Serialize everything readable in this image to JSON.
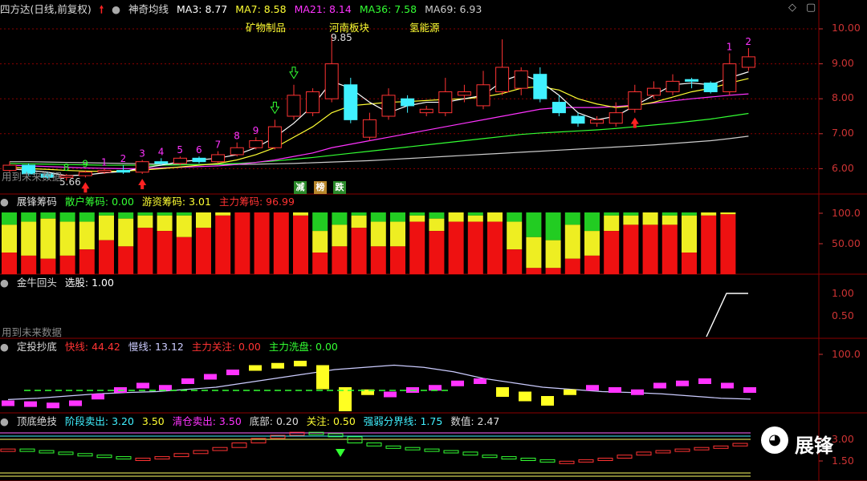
{
  "colors": {
    "up": "#ff3333",
    "down": "#40f0ff",
    "ma3": "#ffffff",
    "ma7": "#ffff33",
    "ma21": "#ff33ff",
    "ma36": "#33ff33",
    "ma69": "#cccccc",
    "grid": "#8b0000",
    "label": "#cc3333",
    "white": "#dddddd",
    "green": "#33ff33",
    "magenta": "#ff33ff",
    "yellow": "#ffff33",
    "cyan": "#40f0ff"
  },
  "panel1": {
    "title": "四方达(日线,前复权)",
    "indicator": "神奇均线",
    "ma3": "MA3: 8.77",
    "ma7": "MA7: 8.58",
    "ma21": "MA21: 8.14",
    "ma36": "MA36: 7.58",
    "ma69": "MA69: 6.93",
    "tags": [
      "矿物制品",
      "河南板块",
      "氢能源"
    ],
    "high_label": "9.85",
    "low_label": "5.66",
    "future_note": "用到未来数据",
    "boxes": [
      "减",
      "榜",
      "跌"
    ],
    "axis": [
      "10.00",
      "9.00",
      "8.00",
      "7.00",
      "6.00"
    ],
    "seq": [
      "8",
      "9",
      "1",
      "2",
      "3",
      "4",
      "5",
      "6",
      "7",
      "8",
      "9",
      "1",
      "2"
    ]
  },
  "panel2": {
    "title": "展锋筹码",
    "s1": "散户筹码: 0.00",
    "s2": "游资筹码: 3.01",
    "s3": "主力筹码: 96.99",
    "axis": [
      "100.0",
      "50.00"
    ]
  },
  "panel3": {
    "title": "金牛回头",
    "s1": "选股: 1.00",
    "note": "用到未来数据",
    "axis": [
      "1.00",
      "0.50"
    ]
  },
  "panel4": {
    "title": "定投抄底",
    "s1": "快线: 44.42",
    "s2": "慢线: 13.12",
    "s3": "主力关注: 0.00",
    "s4": "主力洗盘: 0.00",
    "axis": [
      "100.0"
    ]
  },
  "panel5": {
    "title": "顶底绝技",
    "s1": "阶段卖出: 3.20",
    "s2": "3.50",
    "s3": "清仓卖出: 3.50",
    "s4": "底部: 0.20",
    "s5": "关注: 0.50",
    "s6": "强弱分界线: 1.75",
    "s7": "数值: 2.47",
    "axis": [
      "3.00",
      "1.50"
    ]
  },
  "watermark": "展锋",
  "chart_data": {
    "type": "candlestick",
    "candles": [
      {
        "o": 5.95,
        "c": 6.1,
        "h": 6.2,
        "l": 5.9
      },
      {
        "o": 6.1,
        "c": 5.85,
        "h": 6.15,
        "l": 5.8
      },
      {
        "o": 5.85,
        "c": 5.75,
        "h": 5.9,
        "l": 5.7
      },
      {
        "o": 5.75,
        "c": 5.8,
        "h": 5.85,
        "l": 5.66
      },
      {
        "o": 5.8,
        "c": 5.9,
        "h": 5.95,
        "l": 5.75
      },
      {
        "o": 5.9,
        "c": 5.95,
        "h": 6.0,
        "l": 5.85
      },
      {
        "o": 5.95,
        "c": 5.9,
        "h": 6.1,
        "l": 5.85
      },
      {
        "o": 5.9,
        "c": 6.2,
        "h": 6.25,
        "l": 5.85
      },
      {
        "o": 6.2,
        "c": 6.15,
        "h": 6.3,
        "l": 6.1
      },
      {
        "o": 6.15,
        "c": 6.3,
        "h": 6.35,
        "l": 6.1
      },
      {
        "o": 6.3,
        "c": 6.2,
        "h": 6.35,
        "l": 6.15
      },
      {
        "o": 6.2,
        "c": 6.4,
        "h": 6.5,
        "l": 6.15
      },
      {
        "o": 6.4,
        "c": 6.6,
        "h": 6.75,
        "l": 6.35
      },
      {
        "o": 6.6,
        "c": 6.8,
        "h": 6.9,
        "l": 6.55
      },
      {
        "o": 6.6,
        "c": 7.2,
        "h": 7.4,
        "l": 6.55
      },
      {
        "o": 7.5,
        "c": 8.1,
        "h": 8.4,
        "l": 7.4
      },
      {
        "o": 7.6,
        "c": 8.2,
        "h": 8.3,
        "l": 7.5
      },
      {
        "o": 8.0,
        "c": 9.0,
        "h": 9.85,
        "l": 7.9
      },
      {
        "o": 8.4,
        "c": 7.4,
        "h": 8.6,
        "l": 7.3
      },
      {
        "o": 6.9,
        "c": 7.4,
        "h": 7.6,
        "l": 6.8
      },
      {
        "o": 7.5,
        "c": 8.1,
        "h": 8.3,
        "l": 7.4
      },
      {
        "o": 8.0,
        "c": 7.8,
        "h": 8.1,
        "l": 7.6
      },
      {
        "o": 7.6,
        "c": 7.7,
        "h": 7.8,
        "l": 7.5
      },
      {
        "o": 7.6,
        "c": 8.2,
        "h": 8.6,
        "l": 7.5
      },
      {
        "o": 8.1,
        "c": 8.2,
        "h": 8.4,
        "l": 7.9
      },
      {
        "o": 7.8,
        "c": 8.4,
        "h": 8.8,
        "l": 7.7
      },
      {
        "o": 8.2,
        "c": 8.9,
        "h": 9.7,
        "l": 8.1
      },
      {
        "o": 8.3,
        "c": 8.8,
        "h": 8.9,
        "l": 8.1
      },
      {
        "o": 8.7,
        "c": 8.0,
        "h": 8.9,
        "l": 7.9
      },
      {
        "o": 7.9,
        "c": 7.6,
        "h": 8.1,
        "l": 7.5
      },
      {
        "o": 7.5,
        "c": 7.3,
        "h": 7.6,
        "l": 7.2
      },
      {
        "o": 7.3,
        "c": 7.4,
        "h": 7.5,
        "l": 7.2
      },
      {
        "o": 7.3,
        "c": 7.6,
        "h": 7.9,
        "l": 7.2
      },
      {
        "o": 7.7,
        "c": 8.2,
        "h": 8.4,
        "l": 7.6
      },
      {
        "o": 8.1,
        "c": 8.3,
        "h": 8.5,
        "l": 8.0
      },
      {
        "o": 8.2,
        "c": 8.5,
        "h": 8.7,
        "l": 8.1
      },
      {
        "o": 8.55,
        "c": 8.5,
        "h": 8.6,
        "l": 8.3
      },
      {
        "o": 8.45,
        "c": 8.2,
        "h": 8.5,
        "l": 8.15
      },
      {
        "o": 8.2,
        "c": 9.0,
        "h": 9.3,
        "l": 8.1
      },
      {
        "o": 8.9,
        "c": 9.2,
        "h": 9.45,
        "l": 8.8
      }
    ],
    "ma3": [
      6.0,
      5.95,
      5.9,
      5.8,
      5.82,
      5.88,
      5.92,
      6.02,
      6.1,
      6.2,
      6.25,
      6.3,
      6.4,
      6.6,
      6.9,
      7.3,
      7.8,
      8.5,
      8.3,
      7.9,
      7.6,
      7.8,
      7.9,
      7.9,
      8.0,
      8.1,
      8.5,
      8.7,
      8.5,
      8.1,
      7.6,
      7.4,
      7.5,
      7.8,
      8.1,
      8.4,
      8.45,
      8.4,
      8.6,
      8.77
    ],
    "ma7": [
      6.05,
      6.0,
      5.98,
      5.95,
      5.93,
      5.92,
      5.93,
      5.96,
      6.0,
      6.05,
      6.1,
      6.15,
      6.25,
      6.4,
      6.6,
      6.9,
      7.2,
      7.6,
      7.8,
      7.85,
      7.9,
      7.92,
      7.95,
      7.98,
      8.0,
      8.05,
      8.15,
      8.3,
      8.35,
      8.25,
      8.0,
      7.85,
      7.75,
      7.8,
      7.9,
      8.05,
      8.2,
      8.3,
      8.45,
      8.58
    ],
    "ma21": [
      6.1,
      6.08,
      6.06,
      6.04,
      6.02,
      6.01,
      6.0,
      6.0,
      6.02,
      6.04,
      6.06,
      6.08,
      6.12,
      6.18,
      6.25,
      6.35,
      6.45,
      6.6,
      6.7,
      6.8,
      6.9,
      7.0,
      7.1,
      7.2,
      7.3,
      7.4,
      7.5,
      7.6,
      7.7,
      7.75,
      7.75,
      7.75,
      7.78,
      7.82,
      7.88,
      7.94,
      8.0,
      8.05,
      8.1,
      8.14
    ],
    "ma36": [
      6.15,
      6.14,
      6.13,
      6.12,
      6.11,
      6.1,
      6.1,
      6.1,
      6.1,
      6.11,
      6.12,
      6.13,
      6.15,
      6.18,
      6.22,
      6.27,
      6.32,
      6.38,
      6.44,
      6.5,
      6.56,
      6.62,
      6.68,
      6.74,
      6.8,
      6.86,
      6.92,
      6.98,
      7.02,
      7.05,
      7.08,
      7.11,
      7.15,
      7.2,
      7.25,
      7.3,
      7.36,
      7.42,
      7.5,
      7.58
    ],
    "ma69": [
      6.2,
      6.2,
      6.19,
      6.18,
      6.17,
      6.16,
      6.15,
      6.14,
      6.13,
      6.12,
      6.12,
      6.12,
      6.12,
      6.13,
      6.14,
      6.15,
      6.17,
      6.19,
      6.21,
      6.23,
      6.26,
      6.29,
      6.32,
      6.35,
      6.38,
      6.41,
      6.44,
      6.47,
      6.5,
      6.53,
      6.56,
      6.59,
      6.62,
      6.65,
      6.68,
      6.72,
      6.76,
      6.8,
      6.86,
      6.93
    ],
    "chips": [
      {
        "r": 35,
        "y": 45,
        "g": 20
      },
      {
        "r": 30,
        "y": 55,
        "g": 15
      },
      {
        "r": 25,
        "y": 65,
        "g": 10
      },
      {
        "r": 30,
        "y": 55,
        "g": 15
      },
      {
        "r": 40,
        "y": 45,
        "g": 15
      },
      {
        "r": 55,
        "y": 40,
        "g": 5
      },
      {
        "r": 45,
        "y": 45,
        "g": 10
      },
      {
        "r": 75,
        "y": 20,
        "g": 5
      },
      {
        "r": 70,
        "y": 25,
        "g": 5
      },
      {
        "r": 60,
        "y": 35,
        "g": 5
      },
      {
        "r": 75,
        "y": 25,
        "g": 0
      },
      {
        "r": 95,
        "y": 5,
        "g": 0
      },
      {
        "r": 100,
        "y": 0,
        "g": 0
      },
      {
        "r": 100,
        "y": 0,
        "g": 0
      },
      {
        "r": 100,
        "y": 0,
        "g": 0
      },
      {
        "r": 95,
        "y": 5,
        "g": 0
      },
      {
        "r": 35,
        "y": 35,
        "g": 30
      },
      {
        "r": 45,
        "y": 35,
        "g": 20
      },
      {
        "r": 75,
        "y": 20,
        "g": 5
      },
      {
        "r": 45,
        "y": 40,
        "g": 15
      },
      {
        "r": 45,
        "y": 40,
        "g": 15
      },
      {
        "r": 85,
        "y": 10,
        "g": 5
      },
      {
        "r": 70,
        "y": 20,
        "g": 10
      },
      {
        "r": 85,
        "y": 15,
        "g": 0
      },
      {
        "r": 85,
        "y": 10,
        "g": 5
      },
      {
        "r": 85,
        "y": 15,
        "g": 0
      },
      {
        "r": 40,
        "y": 45,
        "g": 15
      },
      {
        "r": 10,
        "y": 50,
        "g": 40
      },
      {
        "r": 10,
        "y": 45,
        "g": 45
      },
      {
        "r": 25,
        "y": 55,
        "g": 20
      },
      {
        "r": 30,
        "y": 40,
        "g": 30
      },
      {
        "r": 70,
        "y": 25,
        "g": 5
      },
      {
        "r": 80,
        "y": 15,
        "g": 5
      },
      {
        "r": 80,
        "y": 20,
        "g": 0
      },
      {
        "r": 80,
        "y": 15,
        "g": 5
      },
      {
        "r": 35,
        "y": 60,
        "g": 5
      },
      {
        "r": 95,
        "y": 5,
        "g": 0
      },
      {
        "r": 97,
        "y": 3,
        "g": 0
      }
    ],
    "jinniu": [
      0,
      0,
      0,
      0,
      0,
      0,
      0,
      0,
      0,
      0,
      0,
      0,
      0,
      0,
      0,
      0,
      0,
      0,
      0,
      0,
      0,
      0,
      0,
      0,
      0,
      0,
      0,
      0,
      0,
      0,
      0,
      0,
      0,
      0,
      0,
      0,
      0,
      0,
      1,
      1
    ],
    "dingtou_fast": [
      10,
      8,
      5,
      10,
      25,
      40,
      50,
      45,
      60,
      70,
      80,
      90,
      95,
      100,
      90,
      40,
      35,
      30,
      40,
      45,
      55,
      60,
      40,
      30,
      20,
      35,
      45,
      40,
      35,
      50,
      55,
      60,
      50,
      40
    ],
    "dingtou_slow": [
      12,
      15,
      20,
      25,
      28,
      30,
      35,
      40,
      50,
      60,
      70,
      80,
      85,
      90,
      85,
      75,
      60,
      50,
      40,
      35,
      30,
      28,
      25,
      20,
      15,
      13
    ],
    "dingdi_value": [
      2.1,
      2.0,
      1.9,
      1.8,
      1.7,
      1.6,
      1.5,
      1.5,
      1.6,
      1.8,
      2.0,
      2.2,
      2.5,
      2.8,
      3.0,
      3.2,
      3.1,
      2.9,
      2.5,
      2.3,
      2.2,
      2.1,
      2.0,
      1.9,
      1.7,
      1.6,
      1.5,
      1.4,
      1.3,
      1.3,
      1.4,
      1.5,
      1.7,
      1.9,
      2.0,
      2.1,
      2.2,
      2.3,
      2.47
    ]
  }
}
